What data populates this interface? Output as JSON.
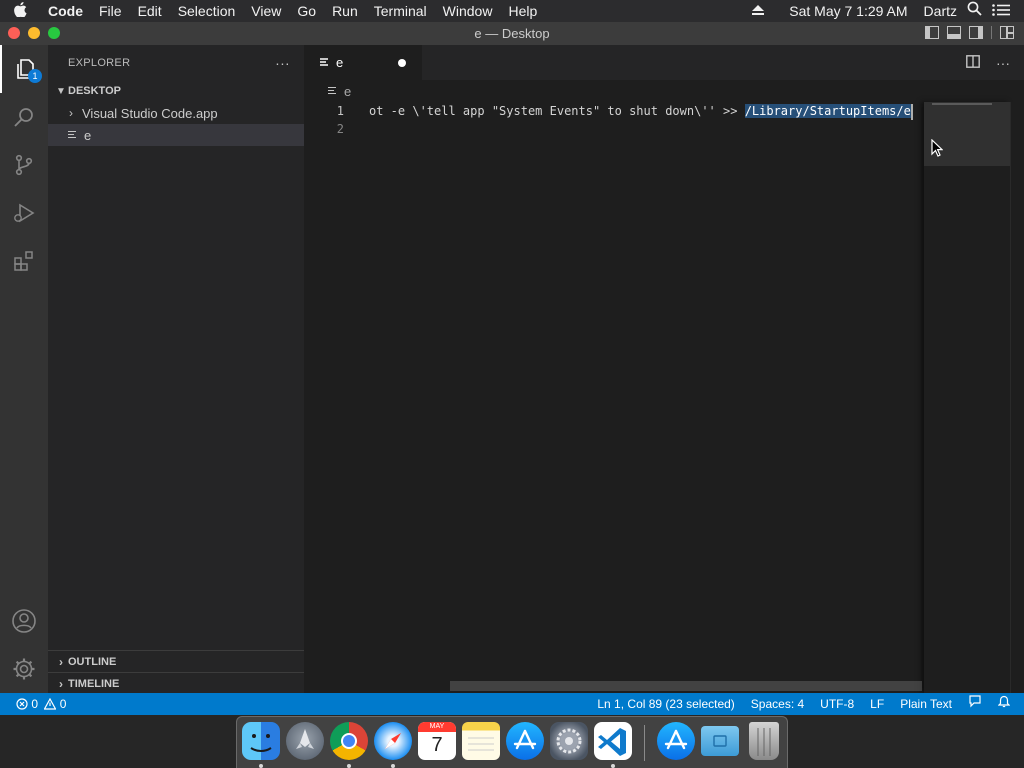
{
  "menubar": {
    "apple_icon": "apple-icon",
    "app_name": "Code",
    "menus": [
      "File",
      "Edit",
      "Selection",
      "View",
      "Go",
      "Run",
      "Terminal",
      "Window",
      "Help"
    ],
    "clock": "Sat May 7  1:29 AM",
    "user": "Dartz"
  },
  "window": {
    "title": "e — Desktop",
    "traffic_light_colors": [
      "#fe5f57",
      "#febc2e",
      "#28c840"
    ]
  },
  "activity_bar": {
    "items": [
      "explorer-icon",
      "search-icon",
      "source-control-icon",
      "run-debug-icon",
      "extensions-icon"
    ],
    "explorer_badge": "1",
    "bottom_items": [
      "accounts-icon",
      "manage-gear-icon"
    ]
  },
  "sidebar": {
    "header": "EXPLORER",
    "folder": "DESKTOP",
    "items": [
      {
        "label": "Visual Studio Code.app",
        "type": "folder"
      },
      {
        "label": "e",
        "type": "file",
        "selected": true
      }
    ],
    "outline": "OUTLINE",
    "timeline": "TIMELINE"
  },
  "editor": {
    "tab_label": "e",
    "tab_dirty": true,
    "breadcrumb": "e",
    "lines": [
      {
        "number": "1",
        "text": "ot -e \\'tell app \"System Events\" to shut down\\'' >> ",
        "selected_text": "/Library/StartupItems/e"
      },
      {
        "number": "2",
        "text": ""
      }
    ]
  },
  "statusbar": {
    "errors": "0",
    "warnings": "0",
    "position": "Ln 1, Col 89 (23 selected)",
    "spaces": "Spaces: 4",
    "encoding": "UTF-8",
    "eol": "LF",
    "language": "Plain Text"
  },
  "dock": {
    "apps": [
      "finder-icon",
      "launchpad-icon",
      "chrome-icon",
      "safari-icon",
      "calendar-icon",
      "notes-icon",
      "app-store-icon",
      "system-preferences-icon",
      "vscode-icon",
      "app-store-downloads-icon",
      "folder-icon",
      "trash-icon"
    ],
    "calendar_month": "MAY",
    "calendar_day": "7",
    "accent": "#007acc"
  }
}
